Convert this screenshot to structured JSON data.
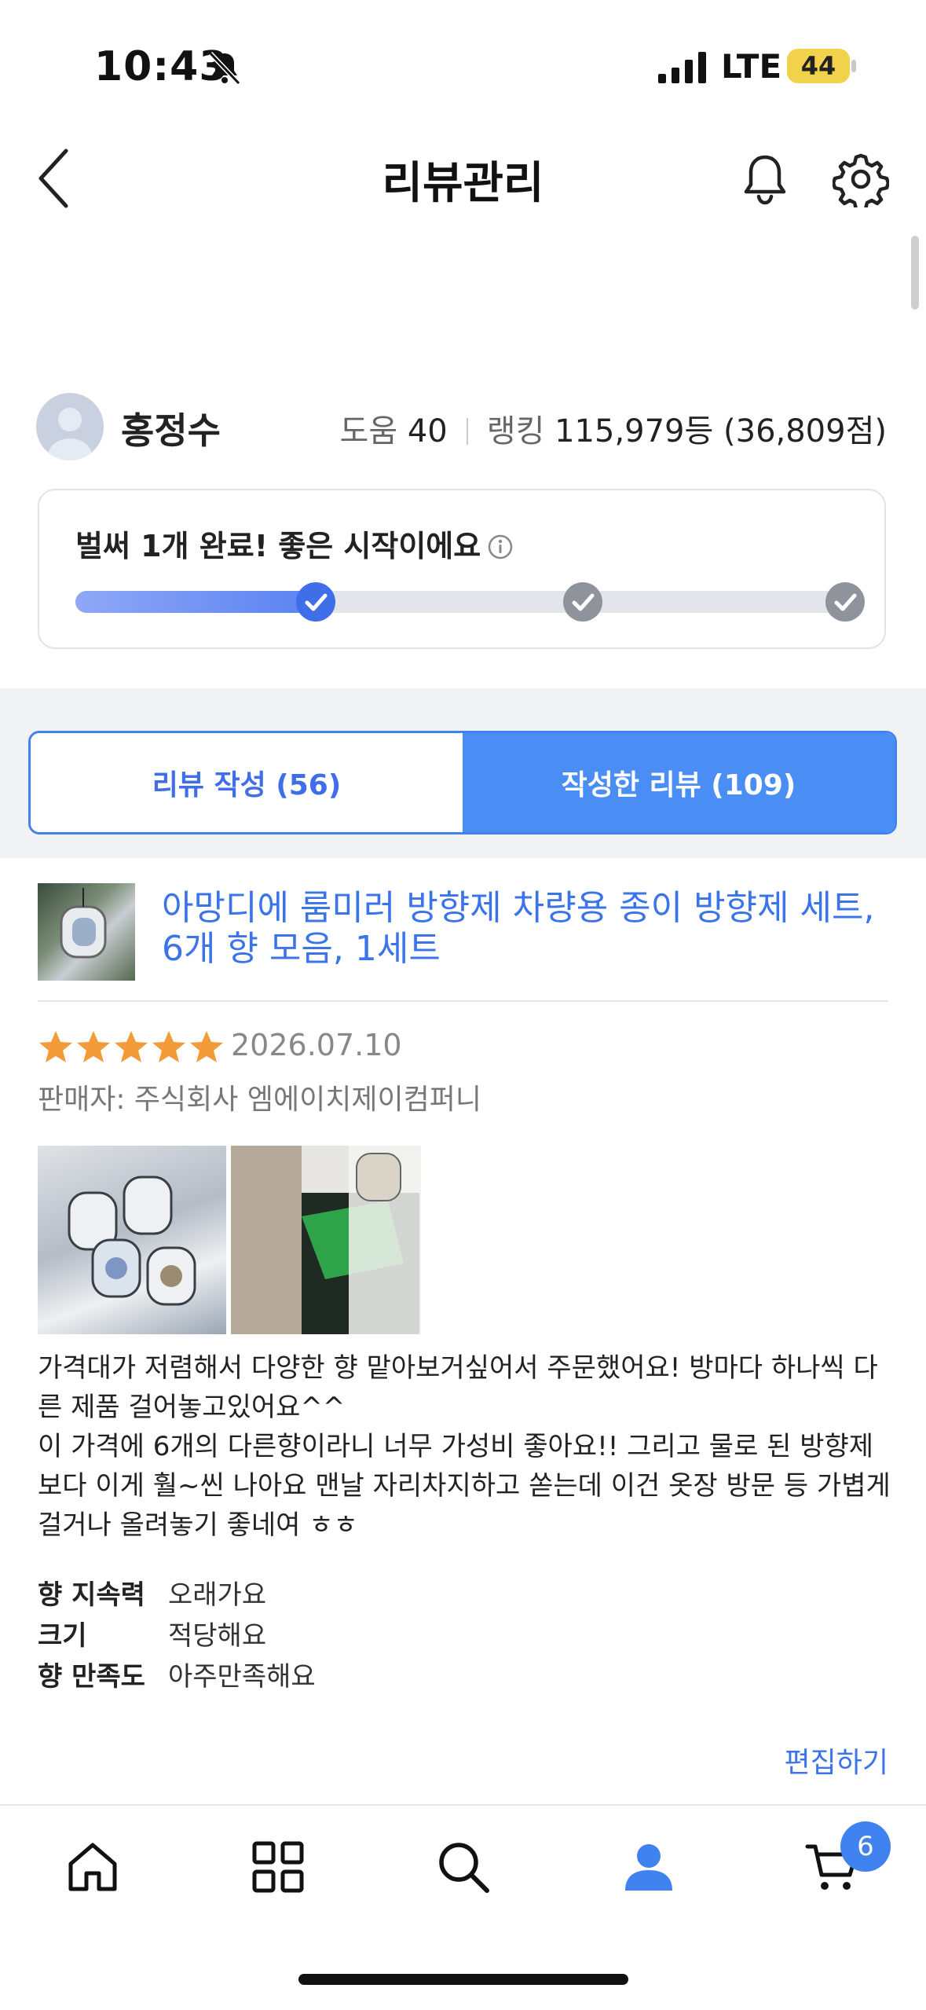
{
  "status_bar": {
    "time": "10:43",
    "network": "LTE",
    "battery": "44"
  },
  "header": {
    "title": "리뷰관리"
  },
  "profile": {
    "name": "홍정수",
    "help_label": "도움",
    "help_value": "40",
    "ranking_label": "랭킹",
    "ranking_value": "115,979등 (36,809점)"
  },
  "progress": {
    "title": "벌써 1개 완료! 좋은 시작이에요",
    "completed_fraction": 0.31,
    "milestones": [
      {
        "position": 0.31,
        "done": true
      },
      {
        "position": 0.655,
        "done": false
      },
      {
        "position": 1.0,
        "done": false
      }
    ]
  },
  "tabs": [
    {
      "label": "리뷰 작성 (56)",
      "active": false
    },
    {
      "label": "작성한 리뷰 (109)",
      "active": true
    }
  ],
  "review": {
    "product_title": "아망디에 룸미러 방향제 차량용 종이 방향제 세트, 6개 향 모음, 1세트",
    "rating": 5,
    "date": "2026.07.10",
    "seller": "판매자: 주식회사 엠에이치제이컴퍼니",
    "body_lines": [
      "가격대가 저렴해서 다양한 향 맡아보거싶어서 주문했어요! 방마다 하나씩 다른 제품 걸어놓고있어요^^",
      "이 가격에 6개의 다른향이라니 너무 가성비 좋아요!! 그리고 물로 된 방향제보다 이게 훨~씬 나아요 맨날 자리차지하고 쏟는데 이건 옷장 방문 등 가볍게 걸거나 올려놓기 좋네여 ㅎㅎ"
    ],
    "attributes": [
      {
        "key": "향 지속력",
        "value": "오래가요"
      },
      {
        "key": "크기",
        "value": "적당해요"
      },
      {
        "key": "향 만족도",
        "value": "아주만족해요"
      }
    ],
    "edit_label": "편집하기"
  },
  "bottom_nav": {
    "items": [
      "home-icon",
      "category-grid-icon",
      "search-icon",
      "profile-icon",
      "cart-icon"
    ],
    "active": "profile-icon",
    "cart_count": "6"
  },
  "colors": {
    "accent": "#3f82f0",
    "star": "#f29b38",
    "link": "#3b74e9"
  }
}
